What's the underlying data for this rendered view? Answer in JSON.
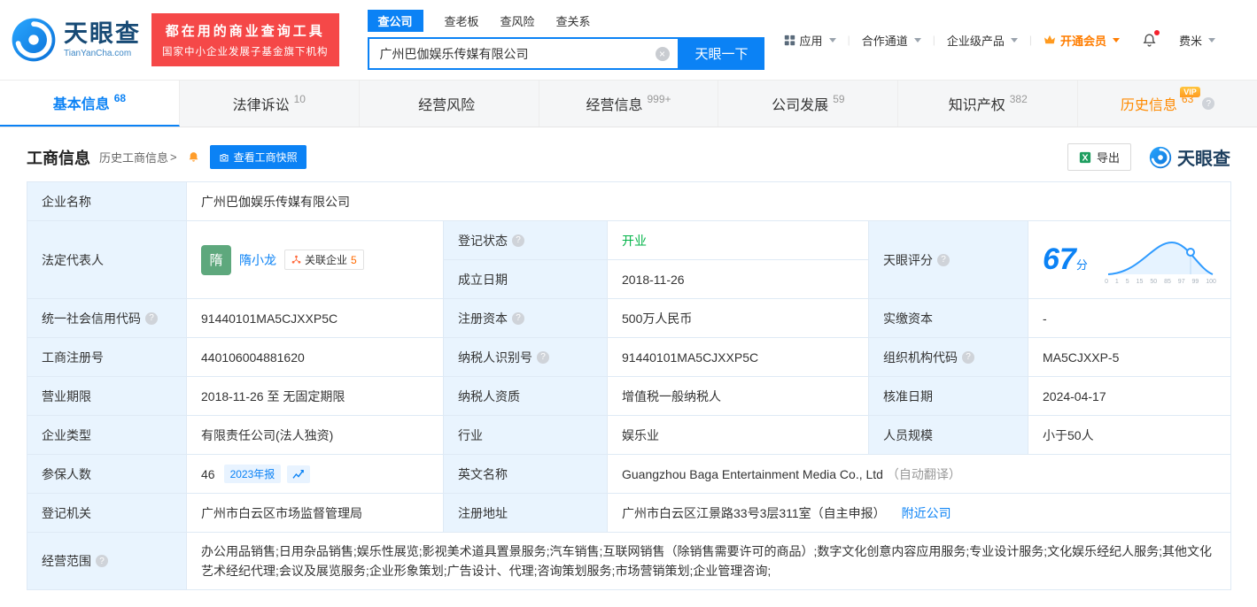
{
  "colors": {
    "primary_blue": "#0b82f5",
    "banner_red": "#f54848",
    "vip_orange": "#ff8a00",
    "status_green": "#00b347",
    "label_cell_bg": "#e9f4fe"
  },
  "icons": {
    "help": "?",
    "close": "×",
    "chevron": ">"
  },
  "header": {
    "logo": {
      "title": "天眼查",
      "domain": "TianYanCha.com"
    },
    "promo": {
      "line1": "都在用的商业查询工具",
      "line2": "国家中小企业发展子基金旗下机构"
    },
    "search_tabs": [
      {
        "label": "查公司"
      },
      {
        "label": "查老板"
      },
      {
        "label": "查风险"
      },
      {
        "label": "查关系"
      }
    ],
    "search": {
      "value": "广州巴伽娱乐传媒有限公司",
      "button": "天眼一下"
    },
    "nav": {
      "apps": "应用",
      "cooperation": "合作通道",
      "enterprise": "企业级产品",
      "vip": "开通会员",
      "user": "费米"
    }
  },
  "tabs": [
    {
      "label": "基本信息",
      "count": "68"
    },
    {
      "label": "法律诉讼",
      "count": "10"
    },
    {
      "label": "经营风险",
      "count": ""
    },
    {
      "label": "经营信息",
      "count": "999+"
    },
    {
      "label": "公司发展",
      "count": "59"
    },
    {
      "label": "知识产权",
      "count": "382"
    },
    {
      "label": "历史信息",
      "count": "63",
      "vip_badge": "VIP"
    }
  ],
  "section": {
    "title": "工商信息",
    "history_link": "历史工商信息",
    "snapshot_button": "查看工商快照",
    "export_button": "导出",
    "watermark": "天眼查"
  },
  "info": {
    "company_name_label": "企业名称",
    "company_name": "广州巴伽娱乐传媒有限公司",
    "legal_rep_label": "法定代表人",
    "legal_rep_avatar": "隋",
    "legal_rep_name": "隋小龙",
    "related_label": "关联企业",
    "related_count": "5",
    "reg_status_label": "登记状态",
    "reg_status": "开业",
    "establish_label": "成立日期",
    "establish_date": "2018-11-26",
    "score_label": "天眼评分",
    "score_value": "67",
    "score_unit": "分",
    "score_axis": [
      "0",
      "1",
      "5",
      "15",
      "50",
      "85",
      "97",
      "99",
      "100"
    ],
    "credit_code_label": "统一社会信用代码",
    "credit_code": "91440101MA5CJXXP5C",
    "reg_capital_label": "注册资本",
    "reg_capital": "500万人民币",
    "paid_capital_label": "实缴资本",
    "paid_capital": "-",
    "reg_number_label": "工商注册号",
    "reg_number": "440106004881620",
    "taxpayer_id_label": "纳税人识别号",
    "taxpayer_id": "91440101MA5CJXXP5C",
    "org_code_label": "组织机构代码",
    "org_code": "MA5CJXXP-5",
    "business_term_label": "营业期限",
    "business_term": "2018-11-26 至 无固定期限",
    "taxpayer_quality_label": "纳税人资质",
    "taxpayer_quality": "增值税一般纳税人",
    "approval_date_label": "核准日期",
    "approval_date": "2024-04-17",
    "company_type_label": "企业类型",
    "company_type": "有限责任公司(法人独资)",
    "industry_label": "行业",
    "industry": "娱乐业",
    "staff_size_label": "人员规模",
    "staff_size": "小于50人",
    "insured_label": "参保人数",
    "insured_count": "46",
    "annual_report_badge": "2023年报",
    "english_name_label": "英文名称",
    "english_name": "Guangzhou Baga Entertainment Media Co., Ltd",
    "english_name_note": "（自动翻译）",
    "reg_authority_label": "登记机关",
    "reg_authority": "广州市白云区市场监督管理局",
    "address_label": "注册地址",
    "address": "广州市白云区江景路33号3层311室（自主申报）",
    "nearby_link": "附近公司",
    "scope_label": "经营范围",
    "scope": "办公用品销售;日用杂品销售;娱乐性展览;影视美术道具置景服务;汽车销售;互联网销售（除销售需要许可的商品）;数字文化创意内容应用服务;专业设计服务;文化娱乐经纪人服务;其他文化艺术经纪代理;会议及展览服务;企业形象策划;广告设计、代理;咨询策划服务;市场营销策划;企业管理咨询;"
  }
}
